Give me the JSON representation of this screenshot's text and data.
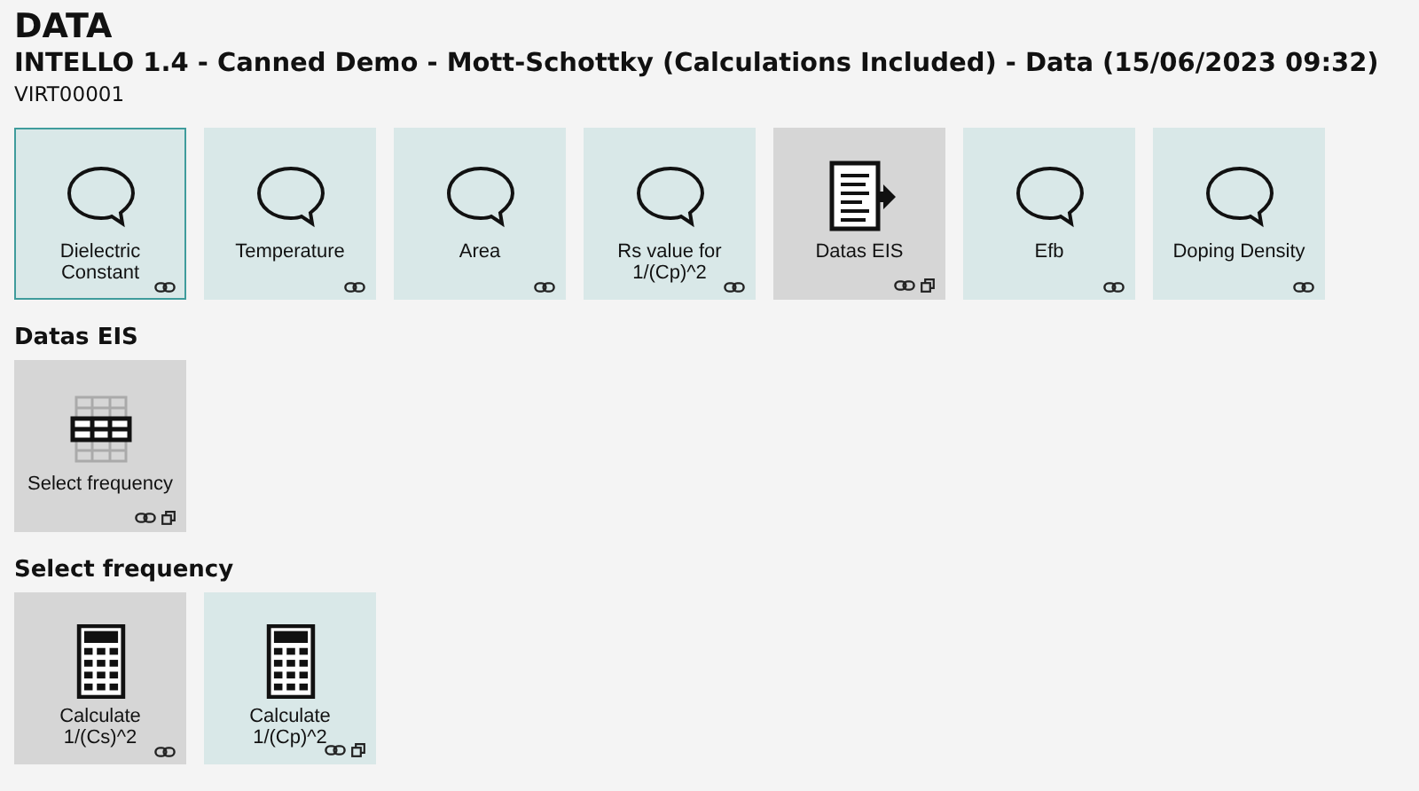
{
  "page_title": "DATA",
  "subtitle": "INTELLO 1.4 - Canned Demo - Mott-Schottky (Calculations Included) - Data (15/06/2023 09:32)",
  "device": "VIRT00001",
  "sections": [
    {
      "tiles": [
        {
          "label": "Dielectric Constant",
          "kind": "comment",
          "color": "#d9e8e8",
          "selected": true,
          "link": true,
          "copy": false
        },
        {
          "label": "Temperature",
          "kind": "comment",
          "color": "#d9e8e8",
          "selected": false,
          "link": true,
          "copy": false
        },
        {
          "label": "Area",
          "kind": "comment",
          "color": "#d9e8e8",
          "selected": false,
          "link": true,
          "copy": false
        },
        {
          "label": "Rs value for 1/(Cp)^2",
          "kind": "comment",
          "color": "#d9e8e8",
          "selected": false,
          "link": true,
          "copy": false
        },
        {
          "label": "Datas EIS",
          "kind": "export",
          "color": "#d6d6d6",
          "selected": false,
          "link": true,
          "copy": true
        },
        {
          "label": "Efb",
          "kind": "comment",
          "color": "#d9e8e8",
          "selected": false,
          "link": true,
          "copy": false
        },
        {
          "label": "Doping Density",
          "kind": "comment",
          "color": "#d9e8e8",
          "selected": false,
          "link": true,
          "copy": false
        }
      ]
    },
    {
      "heading": "Datas EIS",
      "tiles": [
        {
          "label": "Select frequency",
          "kind": "table",
          "color": "#d6d6d6",
          "selected": false,
          "link": true,
          "copy": true
        }
      ]
    },
    {
      "heading": "Select frequency",
      "tiles": [
        {
          "label": "Calculate 1/(Cs)^2",
          "kind": "calculator",
          "color": "#d6d6d6",
          "selected": false,
          "link": true,
          "copy": false
        },
        {
          "label": "Calculate 1/(Cp)^2",
          "kind": "calculator",
          "color": "#d9e8e8",
          "selected": false,
          "link": true,
          "copy": true
        }
      ]
    }
  ]
}
